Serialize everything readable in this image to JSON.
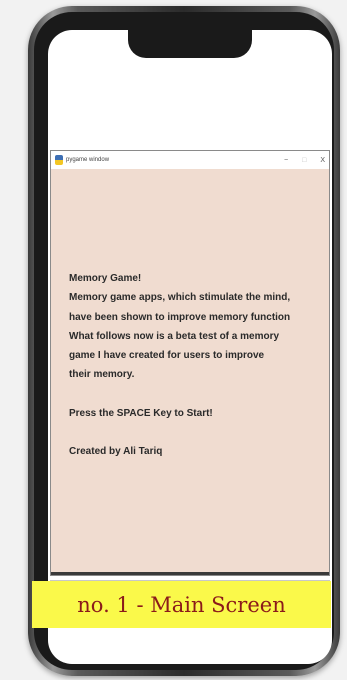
{
  "window": {
    "title": "pygame window",
    "controls": {
      "minimize": "−",
      "maximize": "□",
      "close": "X"
    }
  },
  "content": {
    "lines": [
      "Memory Game!",
      "Memory game apps, which stimulate the mind,",
      "have been shown to improve memory function",
      "What follows now is a beta test of a memory",
      "game I have created for users to improve",
      "their memory.",
      "",
      "Press the SPACE Key to Start!",
      "",
      "Created by Ali Tariq"
    ]
  },
  "caption": {
    "text": "no. 1 - Main Screen"
  },
  "colors": {
    "game_background": "#f0dcd0",
    "caption_background": "#faf94a",
    "caption_text": "#8b1a1a"
  }
}
